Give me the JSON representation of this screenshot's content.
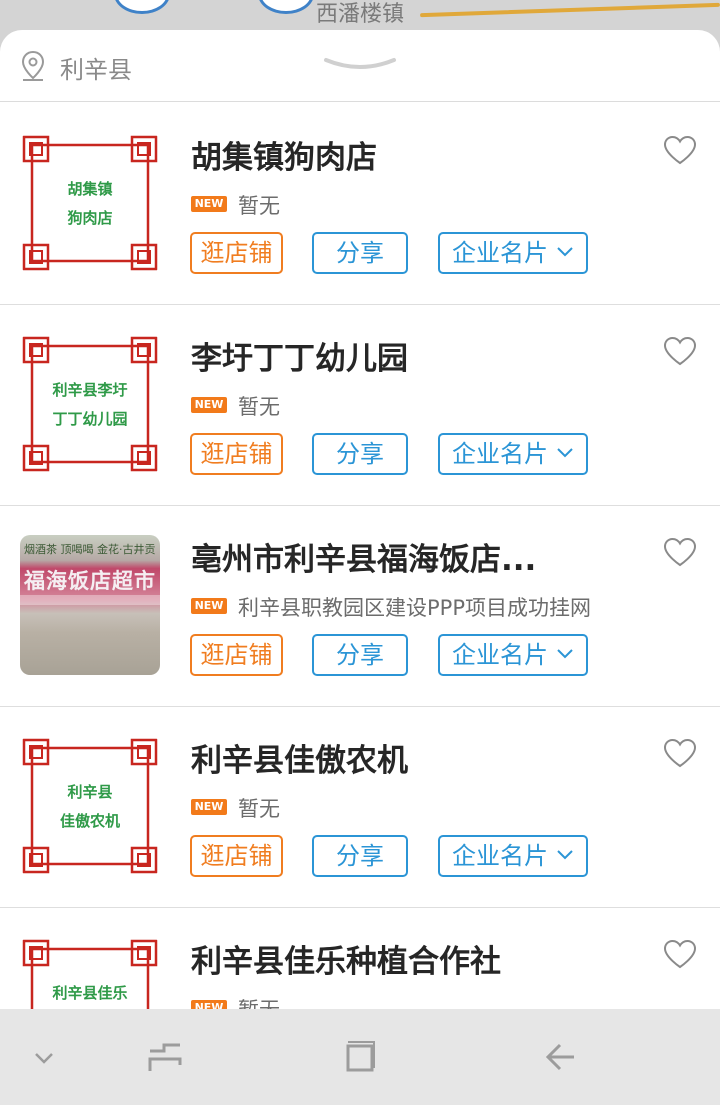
{
  "map": {
    "place_label": "西潘楼镇"
  },
  "header": {
    "location": "利辛县",
    "location_icon": "location-pin-icon",
    "handle_icon": "chevron-down-icon"
  },
  "buttons": {
    "shop": "逛店铺",
    "share": "分享",
    "card": "企业名片"
  },
  "badge": "NEW",
  "colors": {
    "orange": "#f07d20",
    "blue": "#2b95d6",
    "frame_red": "#c8261f",
    "thumb_green": "#2f9a48"
  },
  "items": [
    {
      "title": "胡集镇狗肉店",
      "subtitle": "暂无",
      "thumb_line1": "胡集镇",
      "thumb_line2": "狗肉店"
    },
    {
      "title": "李圩丁丁幼儿园",
      "subtitle": "暂无",
      "thumb_line1": "利辛县李圩",
      "thumb_line2": "丁丁幼儿园"
    },
    {
      "title": "亳州市利辛县福海饭店...",
      "subtitle": "利辛县职教园区建设PPP项目成功挂网",
      "photo_sign": "福海饭店超市",
      "photo_top": "烟酒茶 顶喝喝 金花·古井贡"
    },
    {
      "title": "利辛县佳傲农机",
      "subtitle": "暂无",
      "thumb_line1": "利辛县",
      "thumb_line2": "佳傲农机"
    },
    {
      "title": "利辛县佳乐种植合作社",
      "subtitle": "暂无",
      "thumb_line1": "利辛县佳乐",
      "thumb_line2": ""
    }
  ],
  "navbar": {
    "icons": [
      "chevron-down-icon",
      "recent-apps-icon",
      "home-square-icon",
      "back-arrow-icon"
    ]
  }
}
